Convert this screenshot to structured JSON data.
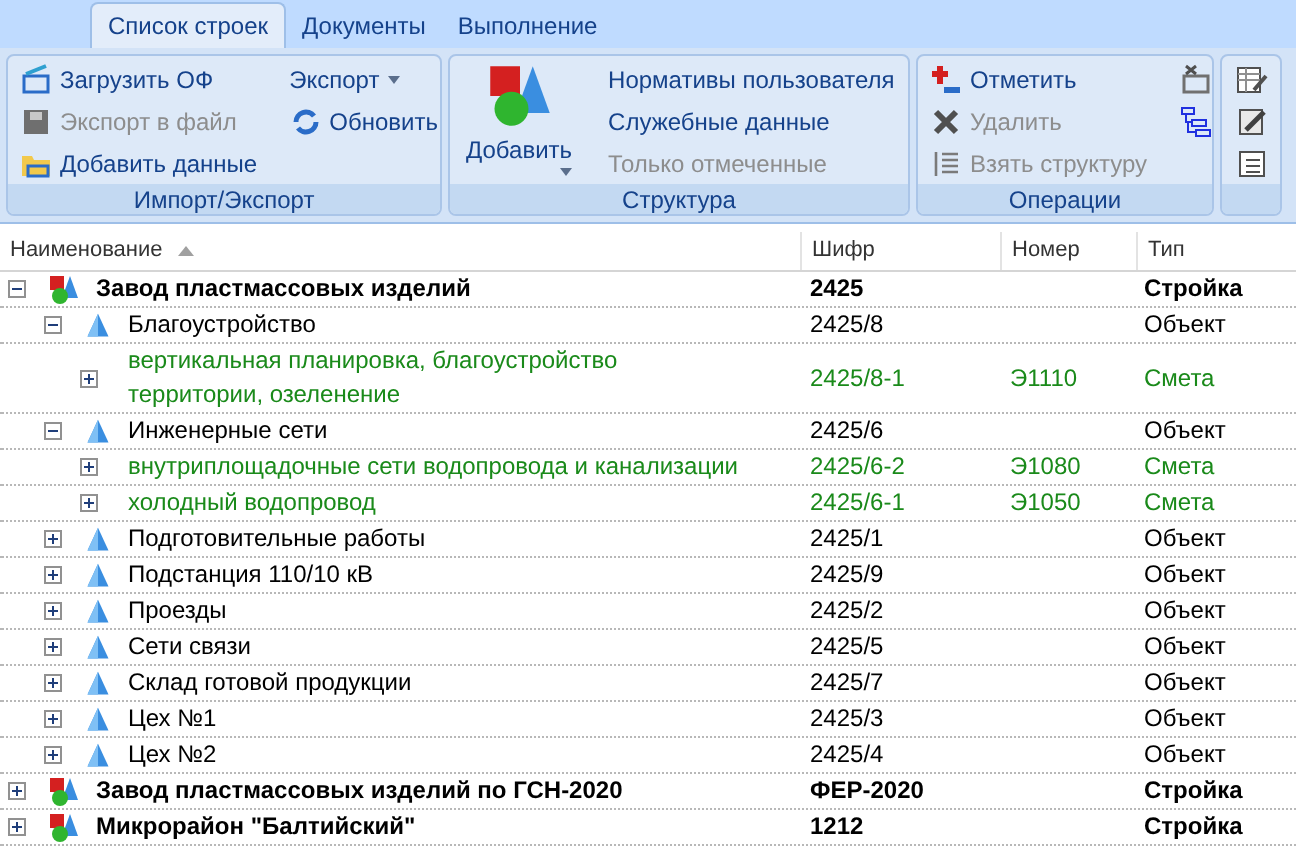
{
  "tabs": [
    {
      "label": "Список строек",
      "selected": true
    },
    {
      "label": "Документы",
      "selected": false
    },
    {
      "label": "Выполнение",
      "selected": false
    }
  ],
  "ribbon": [
    {
      "label": "Импорт/Экспорт",
      "columns": [
        [
          {
            "kind": "small",
            "label": "Загрузить ОФ",
            "disabled": false,
            "dropdown": false
          },
          {
            "kind": "small",
            "label": "Экспорт в файл",
            "disabled": true,
            "dropdown": false
          },
          {
            "kind": "small",
            "label": "Добавить данные",
            "disabled": false,
            "dropdown": false
          }
        ],
        [
          {
            "kind": "text",
            "label": "Экспорт",
            "disabled": false,
            "dropdown": true
          },
          {
            "kind": "small",
            "label": "Обновить",
            "disabled": false,
            "dropdown": false
          }
        ]
      ]
    },
    {
      "label": "Структура",
      "columns": [
        [
          {
            "kind": "large",
            "label": "Добавить",
            "disabled": false,
            "dropdown": true
          }
        ],
        [
          {
            "kind": "text",
            "label": "Нормативы пользователя",
            "disabled": false,
            "dropdown": false
          },
          {
            "kind": "text",
            "label": "Служебные данные",
            "disabled": false,
            "dropdown": false
          },
          {
            "kind": "text",
            "label": "Только отмеченные",
            "disabled": true,
            "dropdown": false
          }
        ]
      ]
    },
    {
      "label": "Операции",
      "columns": [
        [
          {
            "kind": "small",
            "label": "Отметить",
            "disabled": false,
            "dropdown": false
          },
          {
            "kind": "small",
            "label": "Удалить",
            "disabled": true,
            "dropdown": false
          },
          {
            "kind": "small",
            "label": "Взять структуру",
            "disabled": true,
            "dropdown": false
          }
        ],
        [
          {
            "kind": "icon",
            "disabled": false,
            "dropdown": false
          },
          {
            "kind": "icon",
            "disabled": false,
            "dropdown": false
          }
        ]
      ]
    },
    {
      "columns": [
        [
          {
            "kind": "icon",
            "disabled": false,
            "dropdown": false
          },
          {
            "kind": "icon",
            "disabled": false,
            "dropdown": false
          },
          {
            "kind": "icon",
            "disabled": false,
            "dropdown": false
          }
        ]
      ]
    }
  ],
  "table": {
    "columns": [
      {
        "label": "Наименование",
        "sorted": true
      },
      {
        "label": "Шифр",
        "sorted": false
      },
      {
        "label": "Номер",
        "sorted": false
      },
      {
        "label": "Тип",
        "sorted": false
      }
    ],
    "rows": [
      {
        "kind": "stroyka",
        "expanded": true,
        "name": "Завод пластмассовых изделий",
        "code": "2425",
        "type": "Стройка",
        "children": [
          {
            "kind": "object",
            "expanded": true,
            "name": "Благоустройство",
            "code": "2425/8",
            "type": "Объект",
            "children": [
              {
                "kind": "smeta",
                "expanded": false,
                "name": "вертикальная планировка, благоустройство территории, озеленение",
                "code": "2425/8-1",
                "number": "Э1110",
                "type": "Смета"
              }
            ]
          },
          {
            "kind": "object",
            "expanded": true,
            "name": "Инженерные сети",
            "code": "2425/6",
            "type": "Объект",
            "children": [
              {
                "kind": "smeta",
                "expanded": false,
                "name": "внутриплощадочные сети водопровода и канализации",
                "code": "2425/6-2",
                "number": "Э1080",
                "type": "Смета"
              },
              {
                "kind": "smeta",
                "expanded": false,
                "name": "холодный водопровод",
                "code": "2425/6-1",
                "number": "Э1050",
                "type": "Смета"
              }
            ]
          },
          {
            "kind": "object",
            "expanded": false,
            "name": "Подготовительные работы",
            "code": "2425/1",
            "type": "Объект"
          },
          {
            "kind": "object",
            "expanded": false,
            "name": "Подстанция 110/10 кВ",
            "code": "2425/9",
            "type": "Объект"
          },
          {
            "kind": "object",
            "expanded": false,
            "name": "Проезды",
            "code": "2425/2",
            "type": "Объект"
          },
          {
            "kind": "object",
            "expanded": false,
            "name": "Сети связи",
            "code": "2425/5",
            "type": "Объект"
          },
          {
            "kind": "object",
            "expanded": false,
            "name": "Склад готовой продукции",
            "code": "2425/7",
            "type": "Объект"
          },
          {
            "kind": "object",
            "expanded": false,
            "name": "Цех №1",
            "code": "2425/3",
            "type": "Объект"
          },
          {
            "kind": "object",
            "expanded": false,
            "name": "Цех №2",
            "code": "2425/4",
            "type": "Объект"
          }
        ]
      },
      {
        "kind": "stroyka",
        "expanded": false,
        "name": "Завод пластмассовых изделий по ГСН-2020",
        "code": "ФЕР-2020",
        "type": "Стройка"
      },
      {
        "kind": "stroyka",
        "expanded": false,
        "name": "Микрорайон \"Балтийский\"",
        "code": "1212",
        "type": "Стройка"
      }
    ]
  }
}
